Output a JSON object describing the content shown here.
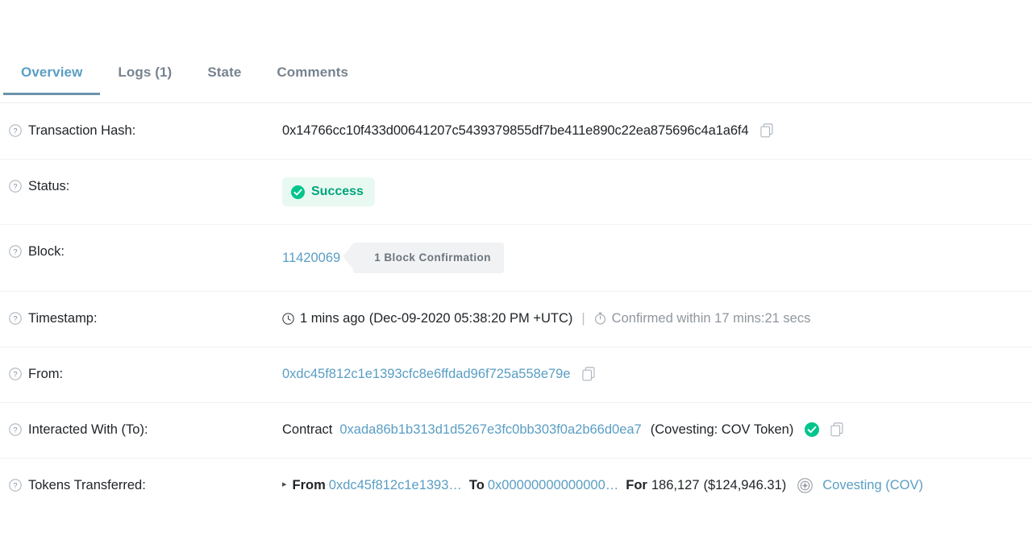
{
  "tabs": [
    {
      "label": "Overview",
      "active": true
    },
    {
      "label": "Logs (1)",
      "active": false
    },
    {
      "label": "State",
      "active": false
    },
    {
      "label": "Comments",
      "active": false
    }
  ],
  "colors": {
    "link": "#5a9ec4",
    "active_tab": "#5a9ec4",
    "tab_underline": "#6b93ab",
    "success_text": "#00a57b",
    "success_bg": "#e8f9f2",
    "verified_green": "#00c58c",
    "muted": "#8f969d",
    "pill_bg": "#f1f2f4",
    "divider": "#f0f1f3"
  },
  "rows": {
    "transaction_hash": {
      "label": "Transaction Hash:",
      "help_icon": "question-circle-icon",
      "value": "0x14766cc10f433d00641207c5439379855df7be411e890c22ea875696c4a1a6f4",
      "copy_icon": "copy-icon"
    },
    "status": {
      "label": "Status:",
      "help_icon": "question-circle-icon",
      "badge_text": "Success",
      "badge_icon": "check-circle-icon"
    },
    "block": {
      "label": "Block:",
      "help_icon": "question-circle-icon",
      "number": "11420069",
      "confirmation_text": "1 Block Confirmation"
    },
    "timestamp": {
      "label": "Timestamp:",
      "help_icon": "question-circle-icon",
      "clock_icon": "clock-icon",
      "relative": "1 mins ago",
      "absolute": "(Dec-09-2020 05:38:20 PM +UTC)",
      "separator": "|",
      "stopwatch_icon": "stopwatch-icon",
      "confirmed_within": "Confirmed within 17 mins:21 secs"
    },
    "from": {
      "label": "From:",
      "help_icon": "question-circle-icon",
      "address": "0xdc45f812c1e1393cfc8e6ffdad96f725a558e79e",
      "copy_icon": "copy-icon"
    },
    "interacted_with": {
      "label": "Interacted With (To):",
      "help_icon": "question-circle-icon",
      "prefix": "Contract",
      "address": "0xada86b1b313d1d5267e3fc0bb303f0a2b66d0ea7",
      "token_name": "(Covesting: COV Token)",
      "verified_icon": "verified-check-icon",
      "copy_icon": "copy-icon"
    },
    "tokens_transferred": {
      "label": "Tokens Transferred:",
      "help_icon": "question-circle-icon",
      "caret": "▸",
      "from_keyword": "From",
      "from_address": "0xdc45f812c1e1393…",
      "to_keyword": "To",
      "to_address": "0x00000000000000…",
      "for_keyword": "For",
      "amount": "186,127",
      "amount_usd": "($124,946.31)",
      "token_logo_icon": "covesting-token-icon",
      "token_link": "Covesting (COV)"
    }
  }
}
